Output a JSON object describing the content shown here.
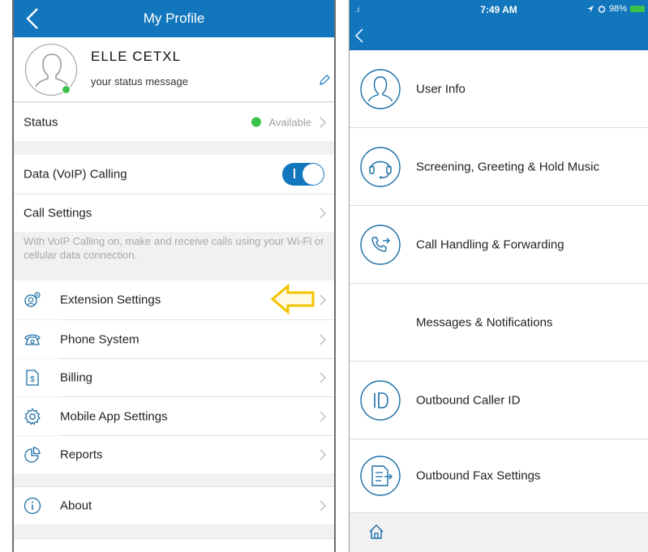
{
  "left": {
    "title": "My Profile",
    "profile": {
      "name": "ELLE CETXL",
      "status_message": "your status message"
    },
    "status": {
      "label": "Status",
      "value": "Available"
    },
    "voip": {
      "label": "Data (VoIP) Calling",
      "enabled": true
    },
    "call_settings": {
      "label": "Call Settings"
    },
    "voip_note": "With VoIP Calling on, make and receive calls using your Wi-Fi or cellular data connection.",
    "menu": [
      {
        "label": "Extension Settings",
        "icon": "extension-settings-icon"
      },
      {
        "label": "Phone System",
        "icon": "phone-system-icon"
      },
      {
        "label": "Billing",
        "icon": "billing-icon"
      },
      {
        "label": "Mobile App Settings",
        "icon": "gear-icon"
      },
      {
        "label": "Reports",
        "icon": "pie-chart-icon"
      }
    ],
    "about": {
      "label": "About",
      "icon": "info-icon"
    },
    "colors": {
      "header": "#1276bd",
      "status_green": "#3cc24b",
      "highlight_arrow": "#f5c400"
    }
  },
  "right": {
    "status_bar": {
      "signal": "..ıl",
      "time": "7:49 AM",
      "battery": "98%"
    },
    "items": [
      {
        "label": "User Info",
        "icon": "user-icon"
      },
      {
        "label": "Screening, Greeting & Hold Music",
        "icon": "headset-icon"
      },
      {
        "label": "Call Handling & Forwarding",
        "icon": "call-forward-icon"
      },
      {
        "label": "Messages & Notifications",
        "icon": ""
      },
      {
        "label": "Outbound Caller ID",
        "icon": "caller-id-icon"
      },
      {
        "label": "Outbound Fax Settings",
        "icon": "fax-icon"
      }
    ],
    "footer_icon": "home-icon"
  }
}
